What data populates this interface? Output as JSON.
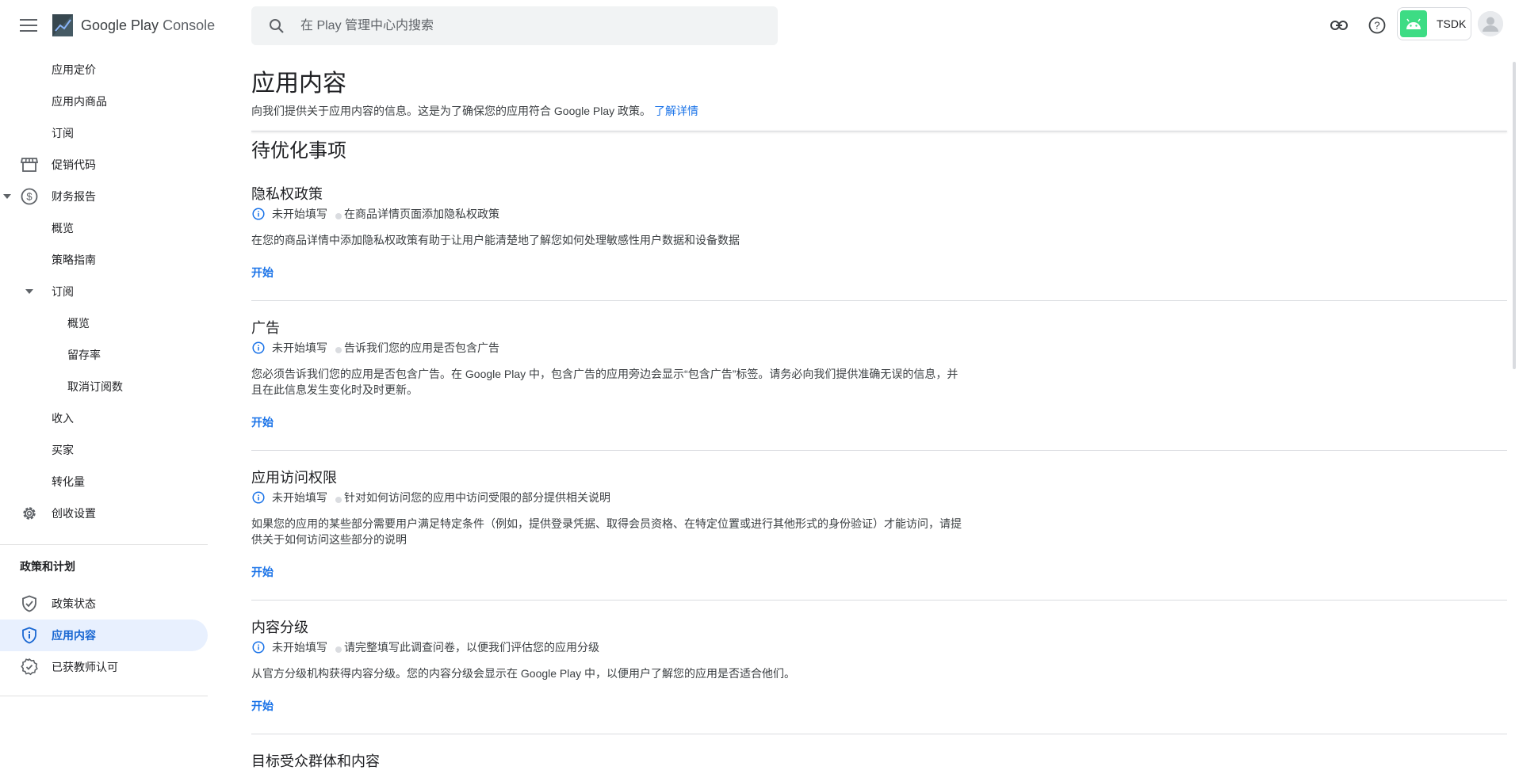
{
  "header": {
    "logo_prefix": "Google Play",
    "logo_suffix": "Console",
    "search_placeholder": "在 Play 管理中心内搜索",
    "app_name": "TSDK"
  },
  "sidebar": {
    "items": [
      {
        "label": "应用定价"
      },
      {
        "label": "应用内商品"
      },
      {
        "label": "订阅"
      },
      {
        "label": "促销代码"
      },
      {
        "label": "财务报告"
      },
      {
        "label": "概览"
      },
      {
        "label": "策略指南"
      },
      {
        "label": "订阅"
      },
      {
        "label": "概览"
      },
      {
        "label": "留存率"
      },
      {
        "label": "取消订阅数"
      },
      {
        "label": "收入"
      },
      {
        "label": "买家"
      },
      {
        "label": "转化量"
      },
      {
        "label": "创收设置"
      }
    ],
    "policy_heading": "政策和计划",
    "policy_items": [
      {
        "label": "政策状态"
      },
      {
        "label": "应用内容"
      },
      {
        "label": "已获教师认可"
      }
    ]
  },
  "main": {
    "title": "应用内容",
    "description": "向我们提供关于应用内容的信息。这是为了确保您的应用符合 Google Play 政策。",
    "learn_more": "了解详情",
    "section_title": "待优化事项",
    "tasks": [
      {
        "title": "隐私权政策",
        "status": "未开始填写",
        "hint": "在商品详情页面添加隐私权政策",
        "description": "在您的商品详情中添加隐私权政策有助于让用户能清楚地了解您如何处理敏感性用户数据和设备数据",
        "action": "开始"
      },
      {
        "title": "广告",
        "status": "未开始填写",
        "hint": "告诉我们您的应用是否包含广告",
        "description": "您必须告诉我们您的应用是否包含广告。在 Google Play 中，包含广告的应用旁边会显示“包含广告”标签。请务必向我们提供准确无误的信息，并且在此信息发生变化时及时更新。",
        "action": "开始"
      },
      {
        "title": "应用访问权限",
        "status": "未开始填写",
        "hint": "针对如何访问您的应用中访问受限的部分提供相关说明",
        "description": "如果您的应用的某些部分需要用户满足特定条件（例如，提供登录凭据、取得会员资格、在特定位置或进行其他形式的身份验证）才能访问，请提供关于如何访问这些部分的说明",
        "action": "开始"
      },
      {
        "title": "内容分级",
        "status": "未开始填写",
        "hint": "请完整填写此调查问卷，以便我们评估您的应用分级",
        "description": "从官方分级机构获得内容分级。您的内容分级会显示在 Google Play 中，以便用户了解您的应用是否适合他们。",
        "action": "开始"
      },
      {
        "title": "目标受众群体和内容"
      }
    ]
  },
  "colors": {
    "accent": "#1a73e8",
    "active_bg": "#e8f0fe",
    "android_green": "#3ddc84"
  }
}
